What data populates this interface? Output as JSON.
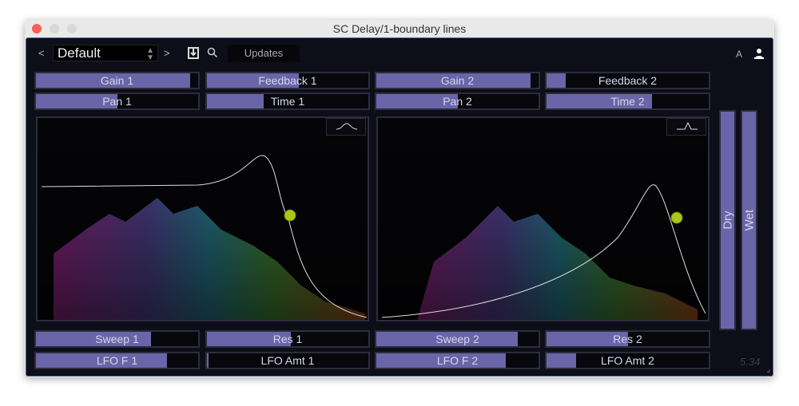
{
  "window": {
    "title": "SC Delay/1-boundary lines"
  },
  "toolbar": {
    "prev": "<",
    "next": ">",
    "preset": "Default",
    "updates": "Updates",
    "a_label": "A",
    "icons": [
      "save-icon",
      "search-icon",
      "user-icon"
    ]
  },
  "sliders": [
    {
      "label": "Gain 1",
      "value": 0.95
    },
    {
      "label": "Feedback 1",
      "value": 0.57
    },
    {
      "label": "Gain 2",
      "value": 0.95
    },
    {
      "label": "Feedback 2",
      "value": 0.12
    },
    {
      "label": "Pan 1",
      "value": 0.5
    },
    {
      "label": "Time 1",
      "value": 0.35
    },
    {
      "label": "Pan 2",
      "value": 0.5
    },
    {
      "label": "Time 2",
      "value": 0.65
    },
    {
      "label": "Sweep 1",
      "value": 0.71
    },
    {
      "label": "Res 1",
      "value": 0.52
    },
    {
      "label": "Sweep 2",
      "value": 0.87
    },
    {
      "label": "Res 2",
      "value": 0.5
    },
    {
      "label": "LFO F 1",
      "value": 0.81
    },
    {
      "label": "LFO Amt 1",
      "value": 0.01
    },
    {
      "label": "LFO F 2",
      "value": 0.8
    },
    {
      "label": "LFO Amt 2",
      "value": 0.18
    }
  ],
  "mix": {
    "dry": "Dry",
    "wet": "Wet",
    "dry_value": 1.0,
    "wet_value": 1.0
  },
  "filters": [
    {
      "shape": "lowpass-icon"
    },
    {
      "shape": "bandpass-icon"
    }
  ],
  "version": "5.34",
  "colors": {
    "slider_fill": "#6a64a8",
    "background": "#0e0e18",
    "handle": "#a8c814"
  }
}
